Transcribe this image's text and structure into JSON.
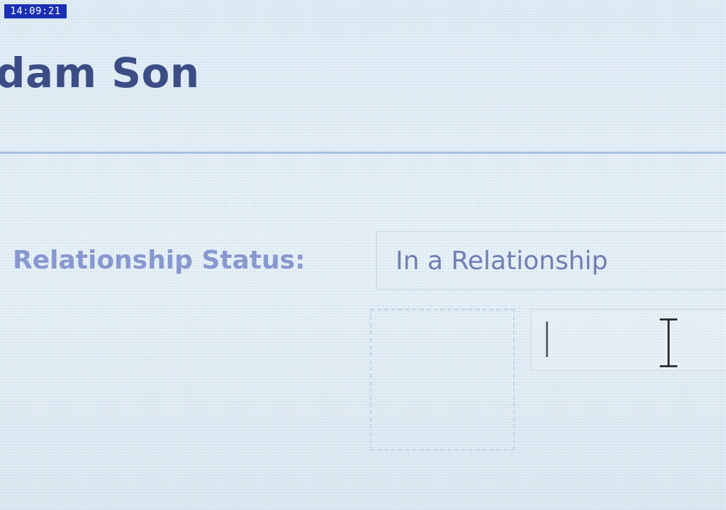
{
  "overlay": {
    "clock": "14:09:21"
  },
  "profile": {
    "name": "dam Son"
  },
  "relationship": {
    "label": "Relationship Status:",
    "value": "In a Relationship"
  },
  "icons": {
    "cursor": "text-ibeam-icon",
    "caret": "text-caret-icon"
  },
  "colors": {
    "name": "#3c4d86",
    "label": "#8898cf",
    "value": "#6f7fb4",
    "divider": "#a9bfe0",
    "clock_background": "#1a2fb4"
  }
}
